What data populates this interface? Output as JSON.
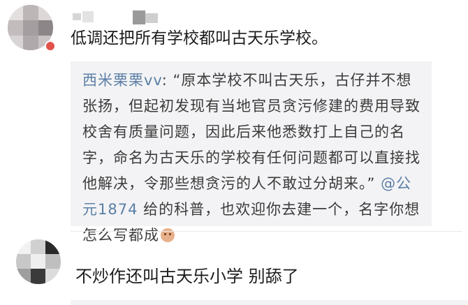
{
  "comment1": {
    "text": "低调还把所有学校都叫古天乐学校。"
  },
  "quote": {
    "author": "西米栗栗vv",
    "separator": ": ",
    "body": "“原本学校不叫古天乐，古仔并不想张扬，但起初发现有当地官员贪污修建的费用导致校舍有质量问题，因此后来他悉数打上自己的名字，命名为古天乐的学校有任何问题都可以直接找他解决，令那些想贪污的人不敢过分胡来。”",
    "mention": "@公元1874",
    "tail": " 给的科普，也欢迎你去建一个，名字你想怎么写都成",
    "emoji": "smiling-face-emoji"
  },
  "comment2": {
    "text": "不炒作还叫古天乐小学 别舔了"
  },
  "colors": {
    "mention": "#5b7fa6",
    "quote_bg": "#f3f3f5",
    "text": "#1c1c1c"
  }
}
